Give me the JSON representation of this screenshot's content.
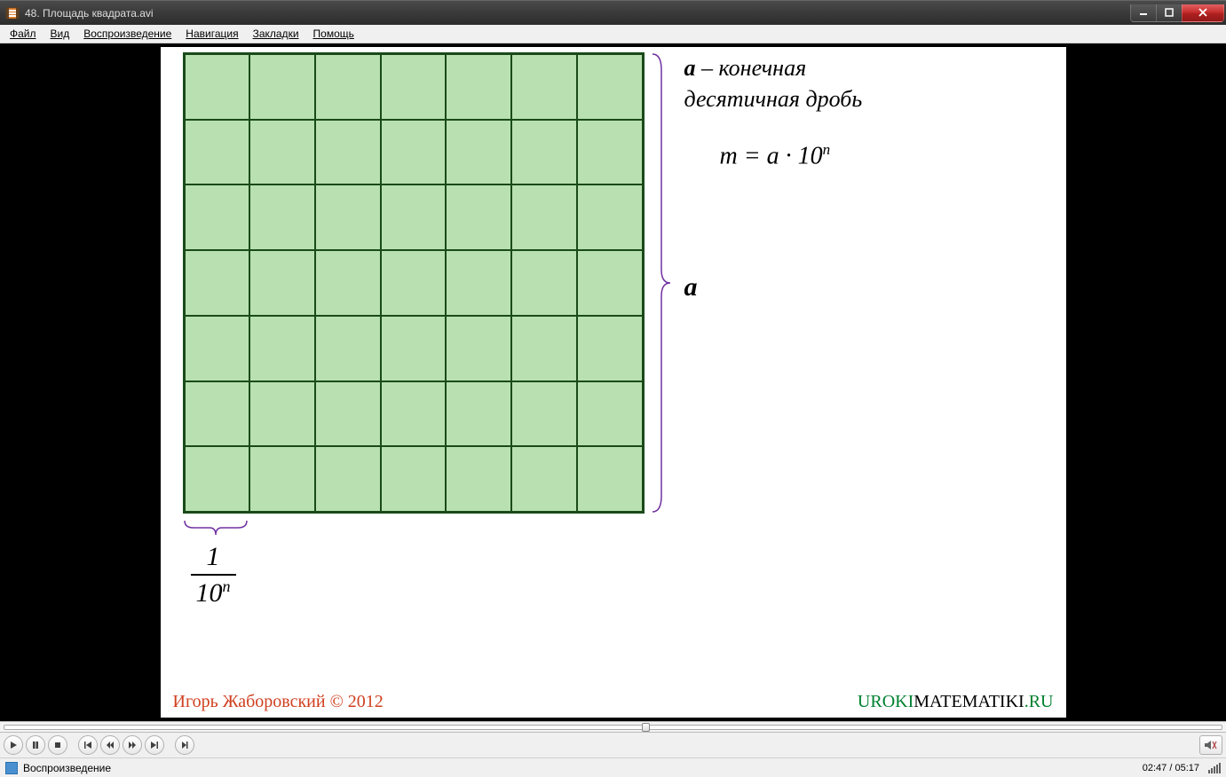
{
  "window": {
    "title": "48. Площадь квадрата.avi"
  },
  "menubar": {
    "items": [
      "Файл",
      "Вид",
      "Воспроизведение",
      "Навигация",
      "Закладки",
      "Помощь"
    ]
  },
  "slide": {
    "top_text_a": "a",
    "top_text_rest1": " – конечная",
    "top_text_line2": "десятичная дробь",
    "formula": "m = a · 10",
    "formula_sup": "n",
    "brace_label": "a",
    "frac_num": "1",
    "frac_den_base": "10",
    "frac_den_sup": "n",
    "credit": "Игорь Жаборовский © 2012",
    "site_part1": "UROKI",
    "site_part2": "MATEMATIKI",
    "site_part3": ".RU"
  },
  "playback": {
    "position_percent": 52.7,
    "current_time": "02:47",
    "total_time": "05:17"
  },
  "status": {
    "label": "Воспроизведение"
  }
}
